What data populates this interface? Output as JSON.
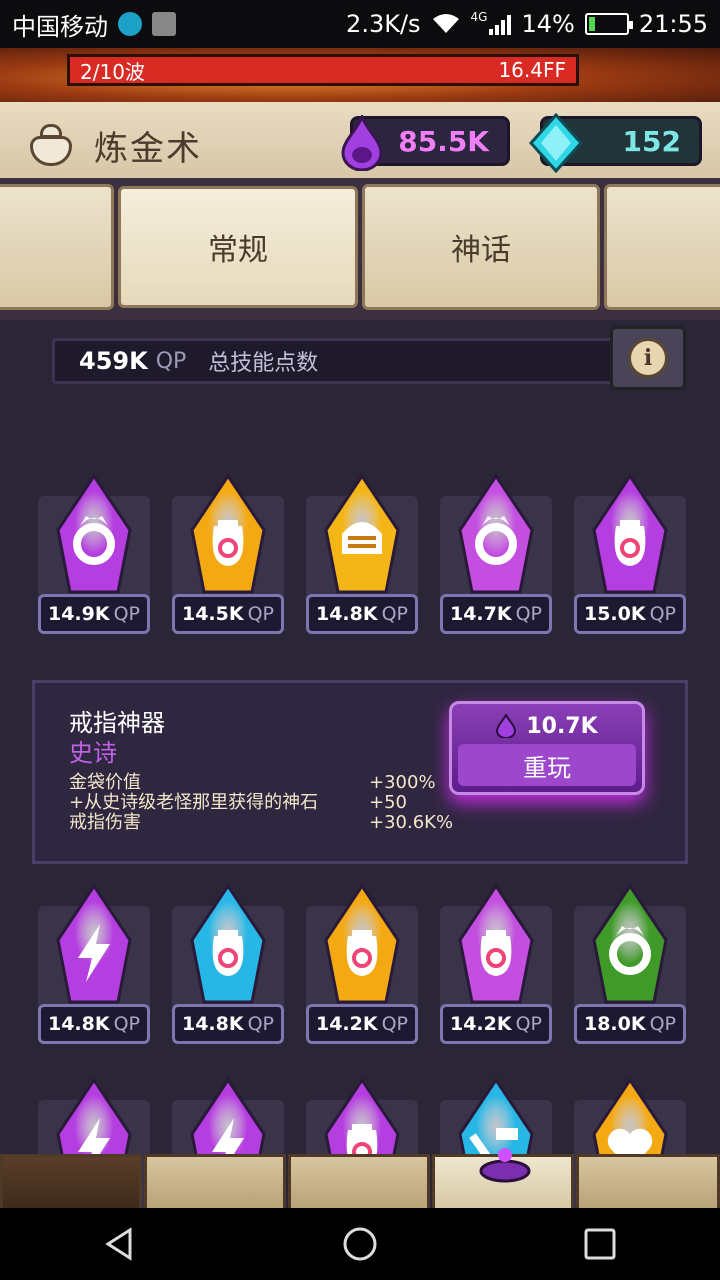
{
  "status_bar": {
    "carrier": "中国移动",
    "speed": "2.3K/s",
    "network": "4G",
    "battery": "14%",
    "time": "21:55"
  },
  "wave": {
    "label": "2/10波",
    "timer": "16.4FF"
  },
  "header": {
    "title": "炼金术",
    "purple_currency": "85.5K",
    "gem_currency": "152"
  },
  "tabs": [
    {
      "label": ""
    },
    {
      "label": "常规"
    },
    {
      "label": "神话"
    },
    {
      "label": ""
    }
  ],
  "qp": {
    "value": "459K",
    "unit": "QP",
    "label": "总技能点数"
  },
  "gems_row1": [
    {
      "value": "14.9K",
      "unit": "QP",
      "color": "#b53ee0",
      "icon": "ring-icon"
    },
    {
      "value": "14.5K",
      "unit": "QP",
      "color": "#f4a912",
      "icon": "money-bag-icon"
    },
    {
      "value": "14.8K",
      "unit": "QP",
      "color": "#f4b517",
      "icon": "helmet-icon"
    },
    {
      "value": "14.7K",
      "unit": "QP",
      "color": "#c44ee0",
      "icon": "ring-icon"
    },
    {
      "value": "15.0K",
      "unit": "QP",
      "color": "#b53ee0",
      "icon": "money-bag-icon"
    }
  ],
  "detail": {
    "title": "戒指神器",
    "rarity": "史诗",
    "stats": [
      {
        "label": "金袋价值",
        "value": "+300%"
      },
      {
        "label": " +从史诗级老怪那里获得的神石",
        "value": "+50"
      },
      {
        "label": "戒指伤害",
        "value": "+30.6K%"
      }
    ],
    "cost": "10.7K",
    "button": "重玩"
  },
  "gems_row2": [
    {
      "value": "14.8K",
      "unit": "QP",
      "color": "#b53ee0",
      "icon": "lightning-icon"
    },
    {
      "value": "14.8K",
      "unit": "QP",
      "color": "#27b7e6",
      "icon": "money-bag-icon"
    },
    {
      "value": "14.2K",
      "unit": "QP",
      "color": "#f4a912",
      "icon": "money-bag-icon"
    },
    {
      "value": "14.2K",
      "unit": "QP",
      "color": "#c44ee0",
      "icon": "money-bag-icon"
    },
    {
      "value": "18.0K",
      "unit": "QP",
      "color": "#3f9a29",
      "icon": "ring-icon"
    }
  ],
  "gems_row3": [
    {
      "color": "#b53ee0",
      "icon": "lightning-icon"
    },
    {
      "color": "#b53ee0",
      "icon": "lightning-icon"
    },
    {
      "color": "#b53ee0",
      "icon": "money-bag-icon"
    },
    {
      "color": "#27b7e6",
      "icon": "hammer-icon"
    },
    {
      "color": "#f4a912",
      "icon": "heart-icon"
    }
  ]
}
